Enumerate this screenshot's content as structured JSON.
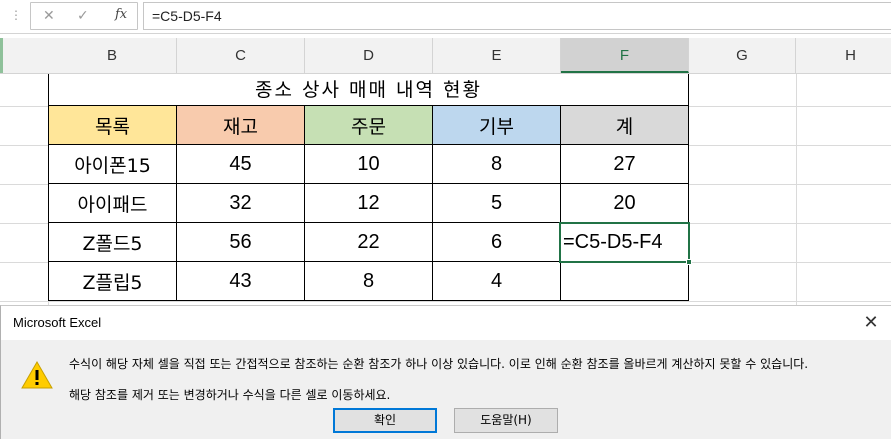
{
  "formula_bar": {
    "cancel_icon": "✕",
    "enter_icon": "✓",
    "fx_label": "fx",
    "formula": "=C5-D5-F4"
  },
  "columns": [
    "B",
    "C",
    "D",
    "E",
    "F",
    "G",
    "H"
  ],
  "selected_column": "F",
  "sheet": {
    "title": "종소 상사 매매 내역 현황",
    "headers": [
      "목록",
      "재고",
      "주문",
      "기부",
      "계"
    ],
    "header_colors": [
      "#ffe699",
      "#f8cbad",
      "#c6e0b4",
      "#bdd7ee",
      "#d9d9d9"
    ],
    "rows": [
      [
        "아이폰15",
        "45",
        "10",
        "8",
        "27"
      ],
      [
        "아이패드",
        "32",
        "12",
        "5",
        "20"
      ],
      [
        "Z폴드5",
        "56",
        "22",
        "6",
        "=C5-D5-F4"
      ],
      [
        "Z플립5",
        "43",
        "8",
        "4",
        ""
      ]
    ]
  },
  "dialog": {
    "title": "Microsoft Excel",
    "close_icon": "✕",
    "icon": "warning-icon",
    "message_line1": "수식이 해당 자체 셀을 직접 또는 간접적으로 참조하는 순환 참조가 하나 이상 있습니다. 이로 인해 순환 참조를 올바르게 계산하지 못할 수 있습니다.",
    "message_line2": "해당 참조를 제거 또는 변경하거나 수식을 다른 셀로 이동하세요.",
    "ok_label": "확인",
    "help_label": "도움말(H)"
  },
  "colors": {
    "excel_green": "#217346",
    "warning_yellow": "#ffcc00"
  }
}
